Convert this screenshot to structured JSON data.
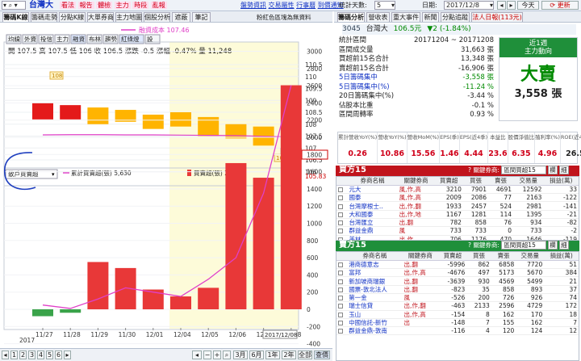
{
  "top": {
    "stock": "台灣大",
    "links": [
      "看法",
      "報告",
      "體檢",
      "主力",
      "時段",
      "亂報"
    ],
    "right_links": [
      "盤勢資訊",
      "交易屬性",
      "行事曆",
      "到價通知"
    ],
    "stat_days_label": "統計天數:",
    "stat_days": "5",
    "date_label": "日期:",
    "date": "2017/12/8",
    "today_btn": "今天",
    "update_btn": "更新"
  },
  "left_tabs": [
    "籌碼K線",
    "籌碼走勢",
    "分點K線",
    "大單券商",
    "主力地圖",
    "個股分析",
    "遮蔽",
    "筆記"
  ],
  "left_note": "粉紅色區塊為無資料",
  "legend": "融資成本 107.46",
  "ind_buttons": [
    "均線",
    "外資",
    "投信",
    "主力",
    "融資",
    "布林",
    "趨勢",
    "紅綠燈",
    "設"
  ],
  "ohlc": "開 107.5  高 107.5  低 106  收 106.5  漲跌 -0.5  漲幅 -0.47%  量 11,248",
  "price_label_108": "108",
  "price_label_106": "106",
  "price_ticks": [
    "110.5",
    "110",
    "109.5",
    "109",
    "108.5",
    "108",
    "107.5",
    "107",
    "106.5",
    "106",
    "105.83"
  ],
  "lower": {
    "select": "散戶買賣超",
    "legend1": "累計買賣超(張) 5,630",
    "legend2": "買賣超(張) 2,605",
    "ticks": [
      "3000",
      "2800",
      "2600",
      "2400",
      "2200",
      "2000",
      "1800",
      "1600",
      "1400",
      "1200",
      "1000",
      "800",
      "600",
      "400",
      "200",
      "0",
      "-200",
      "-400"
    ]
  },
  "chart_data": {
    "type": "bar",
    "categories": [
      "11/27",
      "11/28",
      "11/29",
      "11/30",
      "12/01",
      "12/04",
      "12/05",
      "12/06",
      "12/07",
      "12/08"
    ],
    "year": "2017",
    "cursor_date": "2017/12/08",
    "candles": [
      {
        "open": 108.9,
        "close": 108.2
      },
      {
        "open": 108.8,
        "close": 108.2
      },
      {
        "open": 108.7,
        "close": 108.0
      },
      {
        "open": 108.6,
        "close": 108.1
      },
      {
        "open": 108.4,
        "close": 107.8
      },
      {
        "open": 108.5,
        "close": 107.9
      },
      {
        "open": 108.3,
        "close": 107.5
      },
      {
        "open": 108.0,
        "close": 107.4
      },
      {
        "open": 107.9,
        "close": 107.1
      },
      {
        "open": 107.0,
        "close": 106.5
      }
    ],
    "series": [
      {
        "name": "買賣超(張)",
        "values": [
          -80,
          -40,
          550,
          480,
          230,
          150,
          250,
          1700,
          1530,
          2605
        ]
      },
      {
        "name": "累計買賣超(張)",
        "values": [
          50,
          10,
          120,
          250,
          200,
          150,
          350,
          600,
          1350,
          2605
        ]
      }
    ],
    "cost_line": [
      107.55,
      107.56,
      107.56,
      107.55,
      107.55,
      107.54,
      107.53,
      107.52,
      107.49,
      107.46
    ]
  },
  "bottom": {
    "pages": [
      "1",
      "2",
      "3",
      "4",
      "5",
      "6"
    ],
    "zoom": [
      "3月",
      "6月",
      "1年",
      "2年",
      "全部",
      "查價"
    ]
  },
  "right": {
    "tabs": [
      "籌碼分析",
      "營收表",
      "重大事件",
      "新聞",
      "分點追蹤",
      "法人日報(113元)"
    ],
    "code": "3045",
    "name": "台灣大",
    "price": "106.5元",
    "change": "▼2 (-1.84%)",
    "stats": [
      {
        "label": "統計區間",
        "value": "20171204 ~ 20171208",
        "color": "#222"
      },
      {
        "label": "區間成交量",
        "value": "31,663 張",
        "color": "#222"
      },
      {
        "label": "買超前15名合計",
        "value": "13,348 張",
        "color": "#222"
      },
      {
        "label": "賣超前15名合計",
        "value": "-16,906 張",
        "color": "#222"
      },
      {
        "label": "5日籌碼集中",
        "value": "-3,558 張",
        "color": "#008a00"
      },
      {
        "label": "5日籌碼集中(%)",
        "value": "-11.24 %",
        "color": "#008a00"
      },
      {
        "label": "20日籌碼集中(%)",
        "value": "-3.44 %",
        "color": "#222"
      },
      {
        "label": "佔股本比重",
        "value": "-0.1 %",
        "color": "#222"
      },
      {
        "label": "區間周轉率",
        "value": "0.93 %",
        "color": "#222"
      }
    ],
    "box_title1": "近1週",
    "box_title2": "主力動向",
    "verdict": "大賣",
    "verdict_amount": "3,558 張",
    "fin_headers": [
      "累計營收YoY(%)",
      "營收YoY(%)",
      "營收MoM(%)",
      "EPS(季)",
      "EPS(近4季)",
      "本益比",
      "股價淨值比",
      "殖利率(%)",
      "ROE(近4季)"
    ],
    "fin_values": [
      "0.26",
      "10.86",
      "15.56",
      "1.46",
      "4.44",
      "23.6",
      "6.35",
      "4.96",
      "26.5"
    ],
    "buy_title": "買方15",
    "sell_title": "賣方15",
    "select_label": "關鍵券商:",
    "select_value": "區間買超15",
    "btn1": "欄",
    "btn2": "細",
    "cols": [
      "券商名稱",
      "關鍵券商",
      "買賣超",
      "買張",
      "賣張",
      "交易量",
      "損益(萬)"
    ],
    "buy_rows": [
      [
        "元大",
        "風,作,高",
        "3210",
        "7901",
        "4691",
        "12592",
        "33"
      ],
      [
        "國泰",
        "風,作,高",
        "2009",
        "2086",
        "77",
        "2163",
        "-122"
      ],
      [
        "台灣摩根士..",
        "出,作,翻",
        "1933",
        "2457",
        "524",
        "2981",
        "-141"
      ],
      [
        "大和國泰",
        "出,作,地",
        "1167",
        "1281",
        "114",
        "1395",
        "-21"
      ],
      [
        "台灣匯立",
        "出,翻",
        "782",
        "858",
        "76",
        "934",
        "-82"
      ],
      [
        "群益金鼎",
        "風",
        "733",
        "733",
        "0",
        "733",
        "-2"
      ],
      [
        "美林",
        "出,作",
        "706",
        "1176",
        "470",
        "1646",
        "-119"
      ],
      [
        "摩根大通",
        "出,翻",
        "591",
        "791",
        "200",
        "991",
        "-74"
      ],
      [
        "華泰永昌",
        "風",
        "506",
        "563",
        "57",
        "620",
        "-52"
      ]
    ],
    "sell_rows": [
      [
        "港商德意志",
        "出,翻",
        "-5996",
        "862",
        "6858",
        "7720",
        "51"
      ],
      [
        "富邦",
        "出,作,高",
        "-4676",
        "497",
        "5173",
        "5670",
        "384"
      ],
      [
        "新加坡商瑞銀",
        "出,翻",
        "-3639",
        "930",
        "4569",
        "5499",
        "21"
      ],
      [
        "國票-敦北法人",
        "出,翻",
        "-823",
        "35",
        "858",
        "893",
        "37"
      ],
      [
        "第一金",
        "風",
        "-526",
        "200",
        "726",
        "926",
        "74"
      ],
      [
        "瑞士信貸",
        "出,作,翻",
        "-463",
        "2133",
        "2596",
        "4729",
        "172"
      ],
      [
        "玉山",
        "出,作,高",
        "-154",
        "8",
        "162",
        "170",
        "18"
      ],
      [
        "中國信託-新竹",
        "出",
        "-148",
        "7",
        "155",
        "162",
        "7"
      ],
      [
        "群益金鼎-敦南",
        "",
        "-116",
        "4",
        "120",
        "124",
        "12"
      ]
    ]
  }
}
